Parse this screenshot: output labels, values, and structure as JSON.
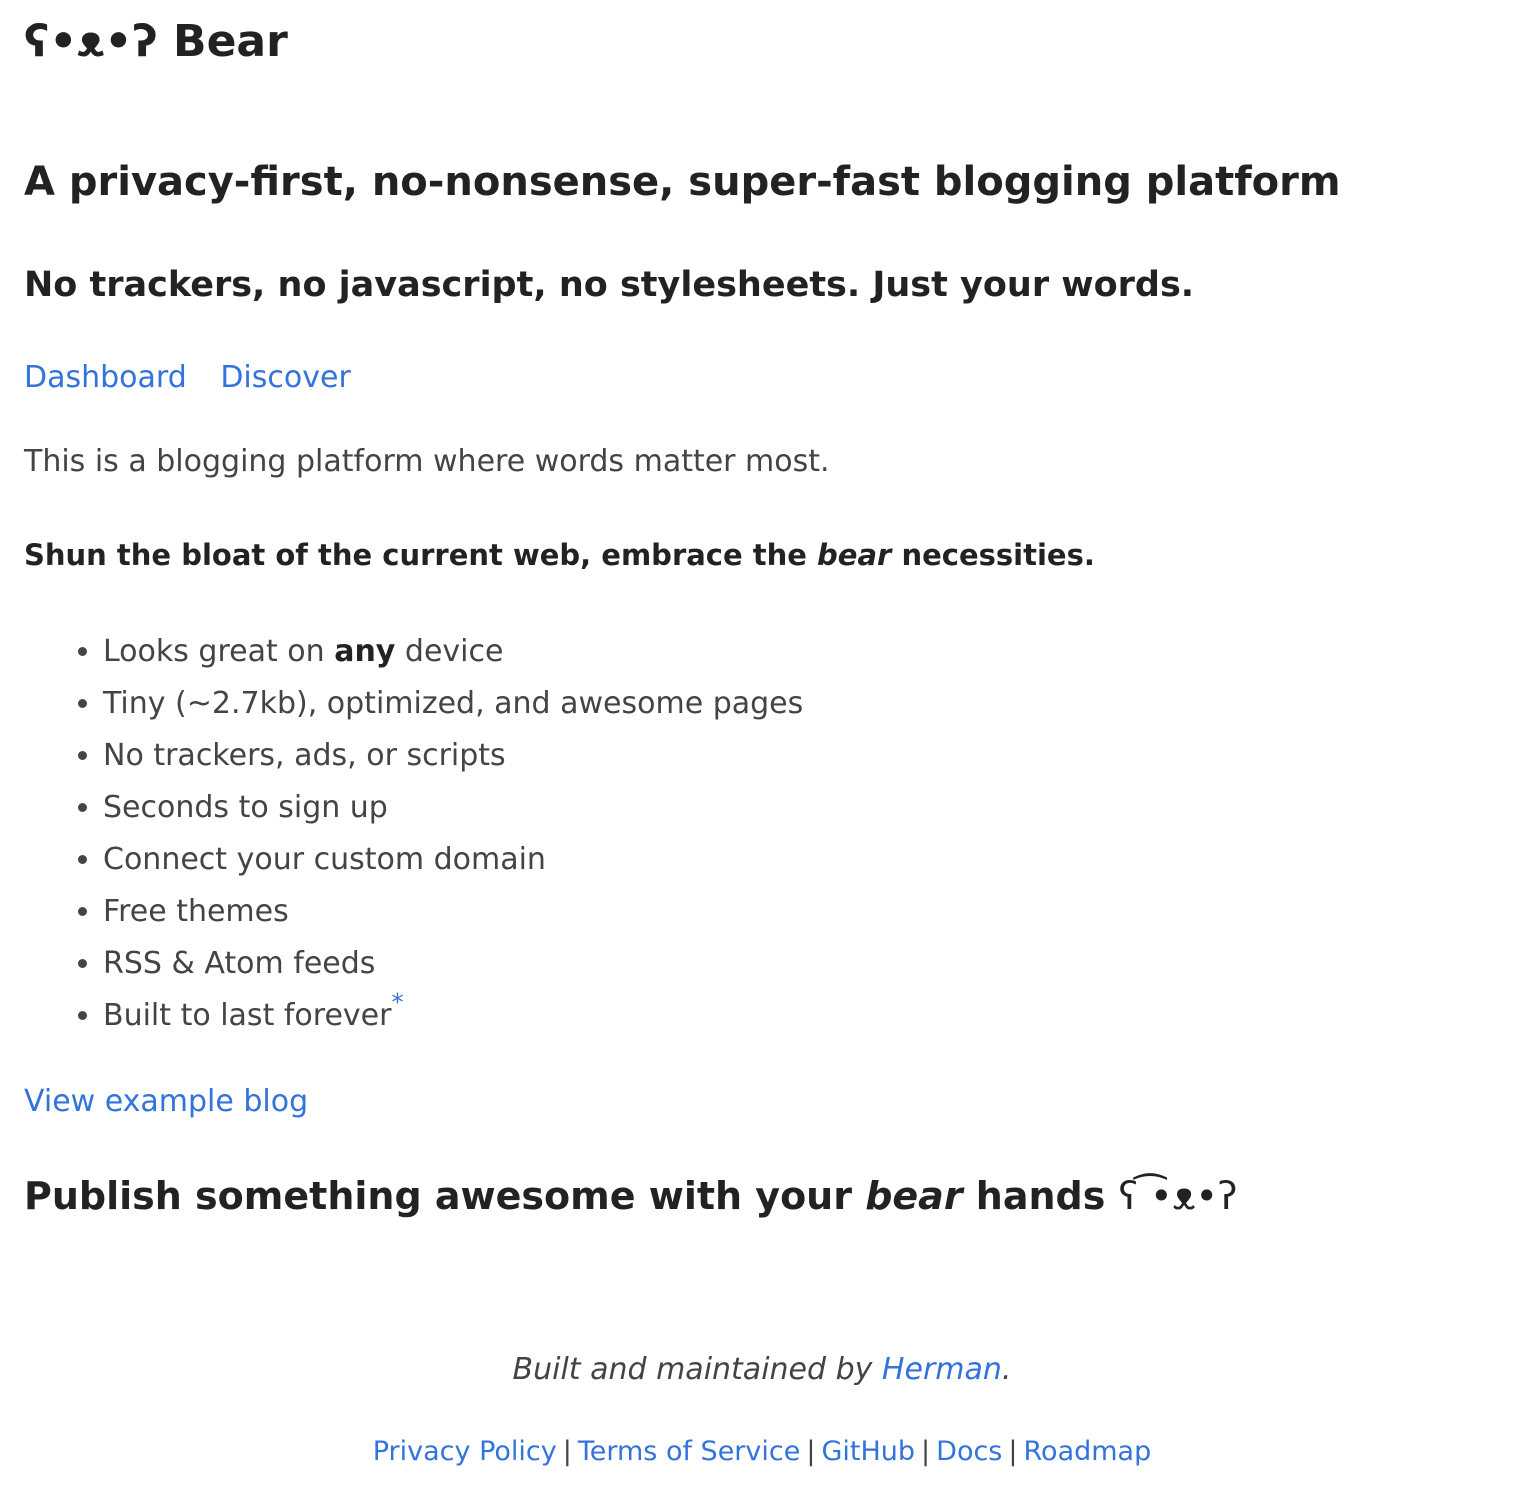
{
  "header": {
    "logo_face": "ʕ•ᴥ•ʔ",
    "title": "Bear"
  },
  "hero": {
    "headline": "A privacy-first, no-nonsense, super-fast blogging platform",
    "tagline": "No trackers, no javascript, no stylesheets. Just your words."
  },
  "nav": {
    "dashboard": "Dashboard",
    "discover": "Discover"
  },
  "intro": "This is a blogging platform where words matter most.",
  "shun": {
    "before": "Shun the bloat of the current web, embrace the ",
    "emphasis": "bear",
    "after": " necessities."
  },
  "features": [
    {
      "before": "Looks great on ",
      "bold": "any",
      "after": " device"
    },
    {
      "text": "Tiny (~2.7kb), optimized, and awesome pages"
    },
    {
      "text": "No trackers, ads, or scripts"
    },
    {
      "text": "Seconds to sign up"
    },
    {
      "text": "Connect your custom domain"
    },
    {
      "text": "Free themes"
    },
    {
      "text": "RSS & Atom feeds"
    },
    {
      "text": "Built to last forever",
      "footnote": "*"
    }
  ],
  "example_link": "View example blog",
  "publish": {
    "before": "Publish something awesome with your ",
    "emphasis": "bear",
    "after": " hands ",
    "face": "ʕ ͡•ᴥ•ʔ"
  },
  "footer": {
    "credit_prefix": "Built and maintained by ",
    "credit_name": "Herman",
    "credit_suffix": ".",
    "links": [
      "Privacy Policy",
      "Terms of Service",
      "GitHub",
      "Docs",
      "Roadmap"
    ],
    "separator": "|"
  },
  "colors": {
    "link": "#3273dc",
    "heading": "#222222",
    "text": "#444444",
    "background": "#ffffff"
  }
}
